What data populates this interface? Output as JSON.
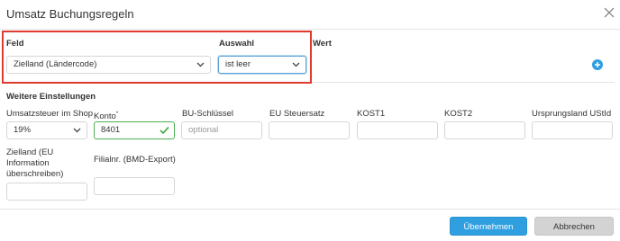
{
  "dialog": {
    "title": "Umsatz Buchungsregeln"
  },
  "rule": {
    "field_label": "Feld",
    "field_value": "Zielland (Ländercode)",
    "selection_label": "Auswahl",
    "selection_value": "ist leer",
    "value_label": "Wert"
  },
  "settings": {
    "heading": "Weitere Einstellungen",
    "vat_label": "Umsatzsteuer im Shop",
    "vat_value": "19%",
    "account_label": "Konto",
    "account_required_mark": "*",
    "account_value": "8401",
    "bu_label": "BU-Schlüssel",
    "bu_placeholder": "optional",
    "eu_tax_label": "EU Steuersatz",
    "kost1_label": "KOST1",
    "kost2_label": "KOST2",
    "origin_vat_label": "Ursprungsland UStId",
    "dest_country_label": "Zielland (EU Information überschreiben)",
    "branch_label": "Filialnr. (BMD-Export)"
  },
  "footer": {
    "apply_label": "Übernehmen",
    "cancel_label": "Abbrechen"
  },
  "colors": {
    "accent": "#2f9fe0",
    "highlight": "#e03a2f",
    "valid": "#4caf50"
  },
  "icons": [
    "close-icon",
    "chevron-down-icon",
    "check-icon",
    "plus-circle-icon"
  ]
}
